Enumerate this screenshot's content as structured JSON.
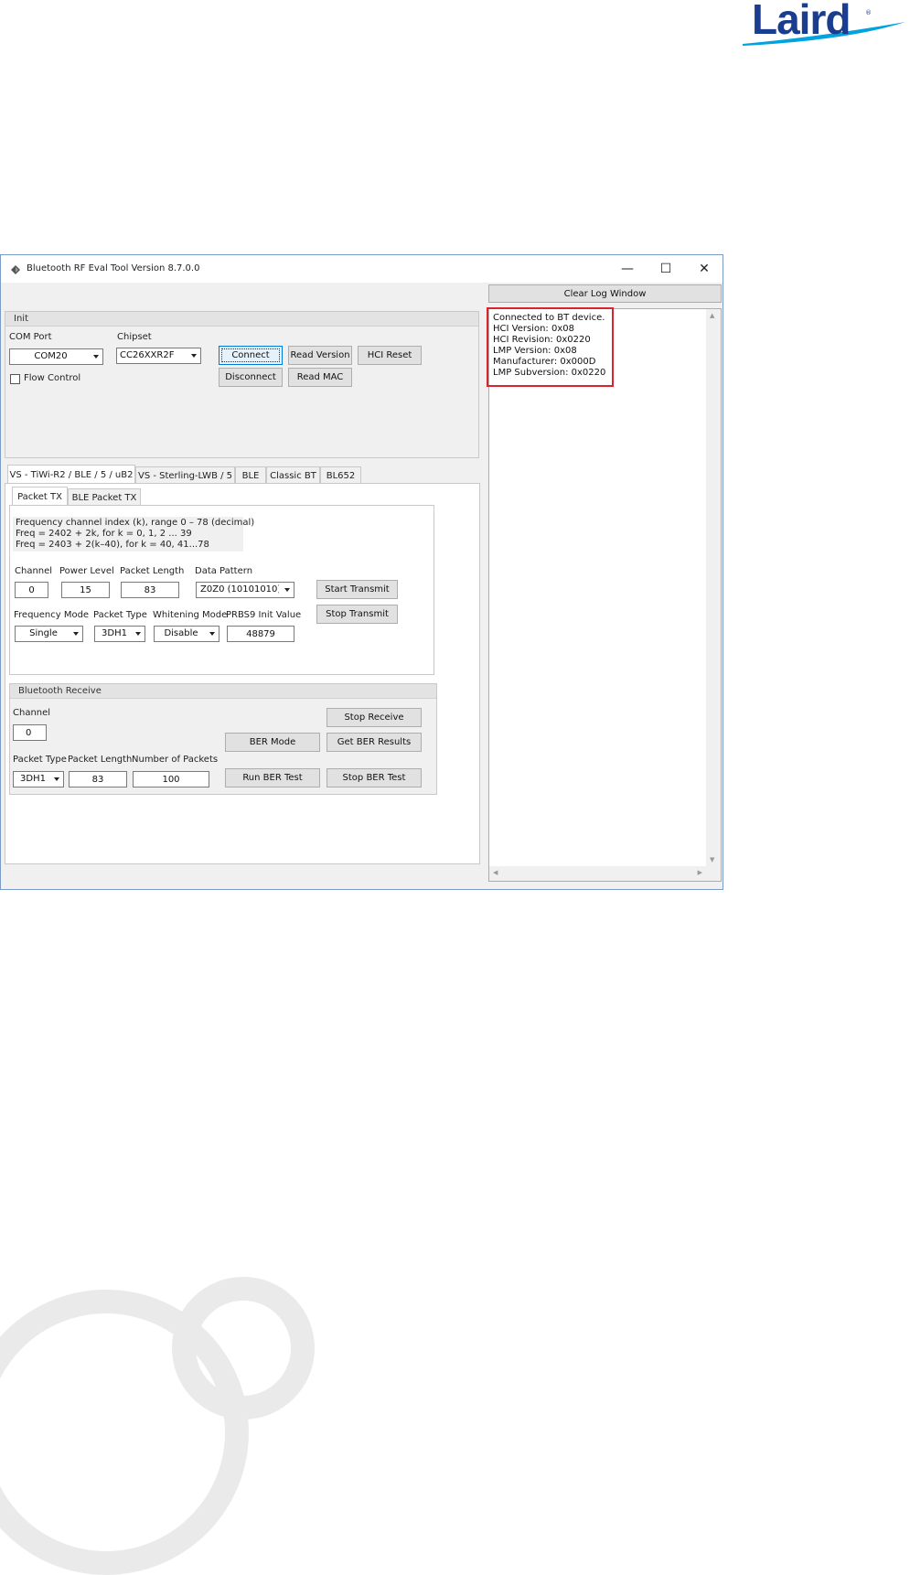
{
  "logo": {
    "text": "Laird",
    "mark": "®"
  },
  "window": {
    "title": "Bluetooth RF Eval Tool  Version 8.7.0.0",
    "minimize_glyph": "—",
    "maximize_glyph": "☐",
    "close_glyph": "✕"
  },
  "log": {
    "clear_label": "Clear Log Window",
    "lines": [
      "Connected to BT device.",
      "HCI Version: 0x08",
      "HCI Revision: 0x0220",
      "LMP Version: 0x08",
      "Manufacturer: 0x000D",
      "LMP Subversion: 0x0220"
    ],
    "scroll_up": "▲",
    "scroll_down": "▼",
    "scroll_left": "◀",
    "scroll_right": "▶"
  },
  "init": {
    "title": "Init",
    "com_port_label": "COM Port",
    "com_port_value": "COM20",
    "chipset_label": "Chipset",
    "chipset_value": "CC26XXR2F",
    "flow_control_label": "Flow Control",
    "flow_control_checked": false,
    "connect": "Connect",
    "read_version": "Read Version",
    "hci_reset": "HCI Reset",
    "disconnect": "Disconnect",
    "read_mac": "Read MAC"
  },
  "tabs": [
    "VS - TiWi-R2 / BLE / 5 / uB2",
    "VS - Sterling-LWB / 5",
    "BLE",
    "Classic BT",
    "BL652"
  ],
  "subtabs": [
    "Packet TX",
    "BLE Packet TX"
  ],
  "tx": {
    "info": [
      "Frequency channel index (k), range 0 – 78 (decimal)",
      "Freq = 2402 + 2k, for k = 0, 1, 2 ... 39",
      "Freq = 2403 + 2(k–40), for k = 40, 41...78"
    ],
    "channel_label": "Channel",
    "channel_value": "0",
    "power_label": "Power Level",
    "power_value": "15",
    "packet_length_label": "Packet Length",
    "packet_length_value": "83",
    "data_pattern_label": "Data Pattern",
    "data_pattern_value": "Z0Z0 (10101010)",
    "start_transmit": "Start Transmit",
    "stop_transmit": "Stop Transmit",
    "freq_mode_label": "Frequency Mode",
    "freq_mode_value": "Single",
    "packet_type_label": "Packet Type",
    "packet_type_value": "3DH1",
    "whitening_label": "Whitening Mode",
    "whitening_value": "Disable",
    "prbs_label": "PRBS9 Init Value",
    "prbs_value": "48879"
  },
  "rx": {
    "title": "Bluetooth Receive",
    "channel_label": "Channel",
    "channel_value": "0",
    "stop_receive": "Stop Receive",
    "ber_mode": "BER Mode",
    "get_ber": "Get BER Results",
    "packet_type_label": "Packet Type",
    "packet_type_value": "3DH1",
    "packet_length_label": "Packet Length",
    "packet_length_value": "83",
    "num_packets_label": "Number of Packets",
    "num_packets_value": "100",
    "run_ber": "Run BER Test",
    "stop_ber": "Stop BER Test"
  }
}
